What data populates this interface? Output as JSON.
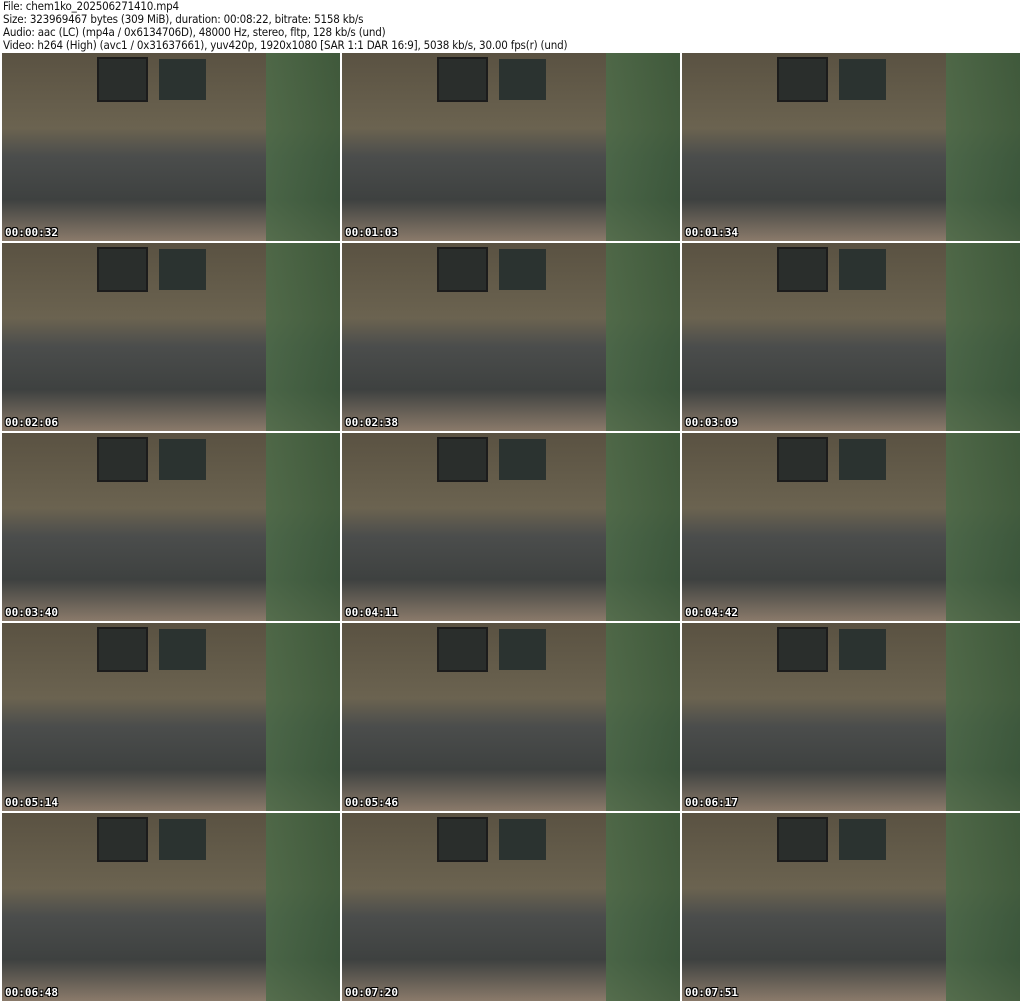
{
  "info": {
    "file": "File: chem1ko_202506271410.mp4",
    "size": "Size: 323969467 bytes (309 MiB), duration: 00:08:22, bitrate: 5158 kb/s",
    "audio": "Audio: aac (LC) (mp4a / 0x6134706D), 48000 Hz, stereo, fltp, 128 kb/s (und)",
    "video": "Video: h264 (High) (avc1 / 0x31637661), yuv420p, 1920x1080 [SAR 1:1 DAR 16:9], 5038 kb/s, 30.00 fps(r) (und)"
  },
  "thumbnails": [
    {
      "timestamp": "00:00:32"
    },
    {
      "timestamp": "00:01:03"
    },
    {
      "timestamp": "00:01:34"
    },
    {
      "timestamp": "00:02:06"
    },
    {
      "timestamp": "00:02:38"
    },
    {
      "timestamp": "00:03:09"
    },
    {
      "timestamp": "00:03:40"
    },
    {
      "timestamp": "00:04:11"
    },
    {
      "timestamp": "00:04:42"
    },
    {
      "timestamp": "00:05:14"
    },
    {
      "timestamp": "00:05:46"
    },
    {
      "timestamp": "00:06:17"
    },
    {
      "timestamp": "00:06:48"
    },
    {
      "timestamp": "00:07:20"
    },
    {
      "timestamp": "00:07:51"
    }
  ]
}
